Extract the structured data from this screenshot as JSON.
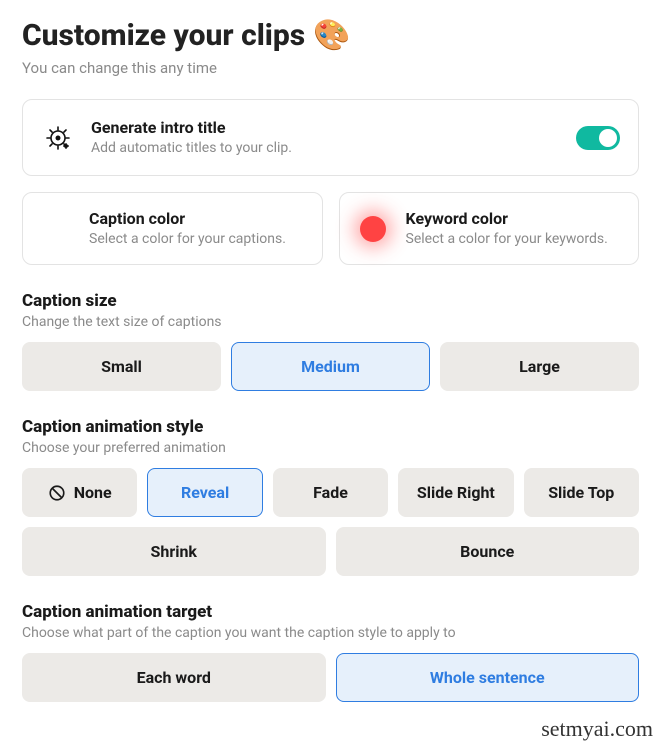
{
  "header": {
    "title": "Customize your clips",
    "emoji": "🎨",
    "subtitle": "You can change this any time"
  },
  "intro": {
    "title": "Generate intro title",
    "desc": "Add automatic titles to your clip.",
    "enabled": true
  },
  "colors": {
    "caption": {
      "title": "Caption color",
      "desc": "Select a color for your captions.",
      "value": ""
    },
    "keyword": {
      "title": "Keyword color",
      "desc": "Select a color for your keywords.",
      "value": "#ff4343"
    }
  },
  "captionSize": {
    "title": "Caption size",
    "desc": "Change the text size of captions",
    "options": [
      "Small",
      "Medium",
      "Large"
    ],
    "selected": "Medium"
  },
  "animationStyle": {
    "title": "Caption animation style",
    "desc": "Choose your preferred animation",
    "options": [
      "None",
      "Reveal",
      "Fade",
      "Slide Right",
      "Slide Top",
      "Shrink",
      "Bounce"
    ],
    "selected": "Reveal"
  },
  "animationTarget": {
    "title": "Caption animation target",
    "desc": "Choose what part of the caption you want the caption style to apply to",
    "options": [
      "Each word",
      "Whole sentence"
    ],
    "selected": "Whole sentence"
  },
  "watermark": "setmyai.com"
}
